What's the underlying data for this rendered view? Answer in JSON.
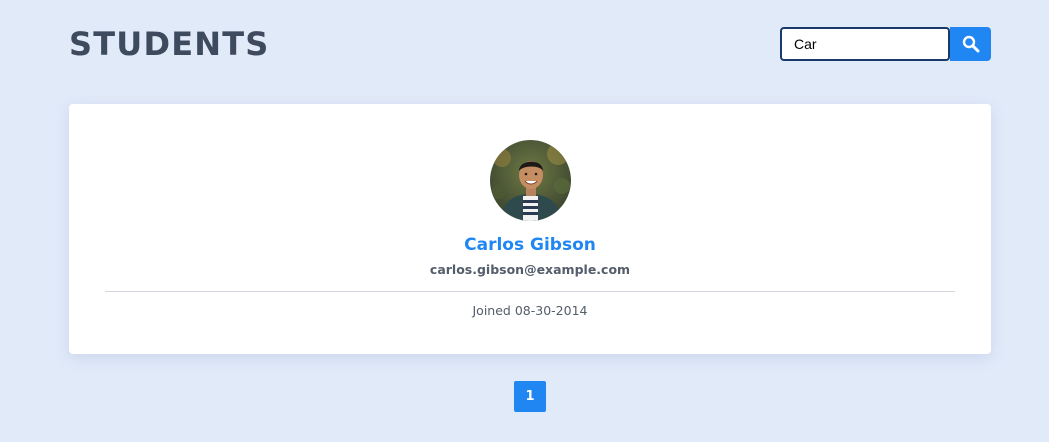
{
  "header": {
    "title": "STUDENTS"
  },
  "search": {
    "value": "Car",
    "button_icon": "search-icon"
  },
  "student": {
    "name": "Carlos Gibson",
    "email": "carlos.gibson@example.com",
    "joined": "Joined 08-30-2014"
  },
  "pagination": {
    "pages": [
      "1"
    ],
    "current": "1"
  },
  "colors": {
    "background": "#e1eaf9",
    "accent": "#1f86f2",
    "title": "#3e4a5d",
    "text": "#545d6a"
  }
}
